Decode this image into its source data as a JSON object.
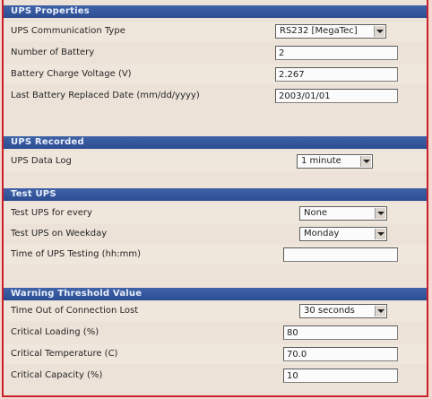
{
  "ups_properties": {
    "header": "UPS Properties",
    "comm_type_label": "UPS Communication Type",
    "comm_type_value": "RS232 [MegaTec]",
    "num_battery_label": "Number of Battery",
    "num_battery_value": "2",
    "charge_voltage_label": "Battery Charge Voltage (V)",
    "charge_voltage_value": "2.267",
    "replaced_date_label": "Last Battery Replaced Date (mm/dd/yyyy)",
    "replaced_date_value": "2003/01/01"
  },
  "ups_recorded": {
    "header": "UPS Recorded",
    "data_log_label": "UPS Data Log",
    "data_log_value": "1 minute"
  },
  "test_ups": {
    "header": "Test UPS",
    "test_every_label": "Test UPS for every",
    "test_every_value": "None",
    "weekday_label": "Test UPS on Weekday",
    "weekday_value": "Monday",
    "time_label": "Time of UPS Testing (hh:mm)",
    "time_value": ""
  },
  "warning": {
    "header": "Warning Threshold Value",
    "conn_lost_label": "Time Out of Connection Lost",
    "conn_lost_value": "30 seconds",
    "loading_label": "Critical Loading (%)",
    "loading_value": "80",
    "temperature_label": "Critical Temperature (C)",
    "temperature_value": "70.0",
    "capacity_label": "Critical Capacity (%)",
    "capacity_value": "10"
  },
  "colors": {
    "header_blue": "#2c4d93",
    "border_red": "#c8202a",
    "panel_bg": "#ece2d8"
  }
}
